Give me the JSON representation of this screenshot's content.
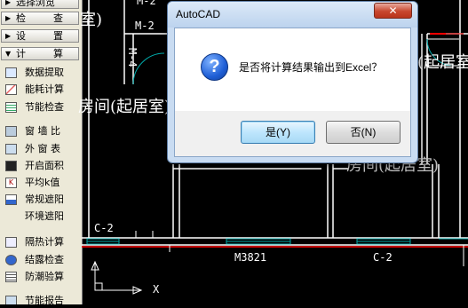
{
  "palette": {
    "categories": [
      {
        "label": "选择浏览",
        "label2": ""
      },
      {
        "label": "检",
        "label2": "查"
      },
      {
        "label": "设",
        "label2": "置"
      },
      {
        "label": "计",
        "label2": "算"
      }
    ],
    "tools": [
      {
        "label": "数据提取",
        "icon": "data-extract-icon"
      },
      {
        "label": "能耗计算",
        "icon": "energy-calc-icon"
      },
      {
        "label": "节能检查",
        "icon": "energy-check-icon"
      },
      {
        "label": "窗 墙 比",
        "icon": "window-wall-ratio-icon"
      },
      {
        "label": "外 窗 表",
        "icon": "window-table-icon"
      },
      {
        "label": "开启面积",
        "icon": "open-area-icon"
      },
      {
        "label": "平均k值",
        "icon": "average-k-icon"
      },
      {
        "label": "常规遮阳",
        "icon": "shading-icon"
      },
      {
        "label": "环境遮阳",
        "icon": ""
      },
      {
        "label": "隔热计算",
        "icon": "insulation-icon"
      },
      {
        "label": "结露检查",
        "icon": "condensation-icon"
      },
      {
        "label": "防潮验算",
        "icon": "moisture-icon"
      },
      {
        "label": "节能报告",
        "icon": "report-icon"
      }
    ]
  },
  "drawing": {
    "labels": {
      "room1": "室)",
      "door_m2": "M-2",
      "door_m4": "M-4",
      "room2": "房间(起居室)",
      "room3": "间(起居室)",
      "room4": "房间(起居室)",
      "window_c2_left": "C-2",
      "window_m3821": "M3821",
      "window_c2_right": "C-2",
      "axis_x": "X",
      "top_m2": "M-2"
    }
  },
  "dialog": {
    "title": "AutoCAD",
    "close_label": "✕",
    "icon": "question-icon",
    "icon_glyph": "?",
    "message": "是否将计算结果输出到Excel？",
    "yes_label": "是(Y)",
    "no_label": "否(N)"
  },
  "colors": {
    "cad_background": "#000000",
    "wall_line": "#ffffff",
    "section_red": "#ff0000",
    "window_cyan": "#00c0c0",
    "dialog_frame": "#c9dcf2"
  }
}
